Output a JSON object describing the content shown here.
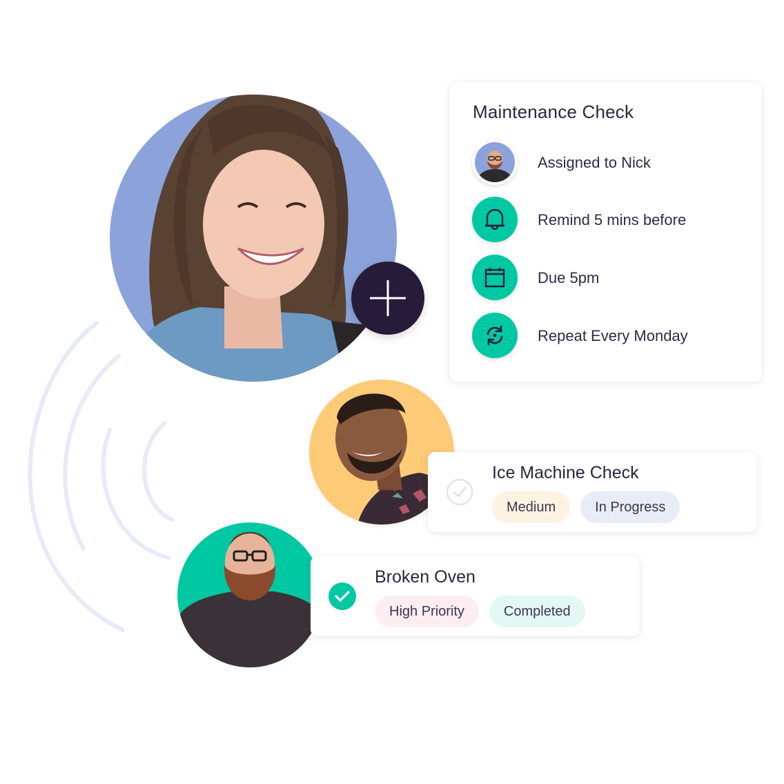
{
  "colors": {
    "accent_teal": "#00C8A3",
    "dark_navy": "#261C3A",
    "avatar_blue_bg": "#8BA3DA",
    "avatar_yellow_bg": "#FDCB77",
    "avatar_teal_bg": "#00C8A3",
    "arc_color": "#E6EBF7"
  },
  "add_button": {
    "icon": "plus-icon"
  },
  "maintenance_card": {
    "title": "Maintenance Check",
    "rows": [
      {
        "icon": "avatar-nick",
        "label": "Assigned to Nick"
      },
      {
        "icon": "bell-icon",
        "label": "Remind 5 mins before"
      },
      {
        "icon": "calendar-icon",
        "label": "Due 5pm"
      },
      {
        "icon": "repeat-icon",
        "label": "Repeat Every Monday"
      }
    ]
  },
  "tasks": [
    {
      "title": "Ice Machine Check",
      "completed": false,
      "badges": [
        {
          "label": "Medium",
          "bg": "#FDF3E2"
        },
        {
          "label": "In Progress",
          "bg": "#E8ECF7"
        }
      ]
    },
    {
      "title": "Broken Oven",
      "completed": true,
      "badges": [
        {
          "label": "High Priority",
          "bg": "#FDEEF1"
        },
        {
          "label": "Completed",
          "bg": "#E3F8F4"
        }
      ]
    }
  ]
}
